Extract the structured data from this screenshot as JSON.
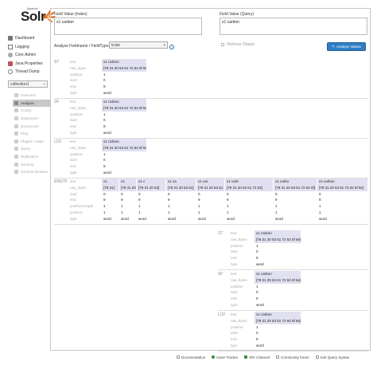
{
  "logo": {
    "apache": "Apache",
    "solr": "Solr"
  },
  "nav": [
    {
      "label": "Dashboard",
      "icon": "dashboard-icon"
    },
    {
      "label": "Logging",
      "icon": "logging-icon"
    },
    {
      "label": "Core Admin",
      "icon": "core-admin-icon"
    },
    {
      "label": "Java Properties",
      "icon": "java-icon"
    },
    {
      "label": "Thread Dump",
      "icon": "thread-icon"
    }
  ],
  "core_select": {
    "value": "collection1",
    "caret": "÷"
  },
  "sub_nav": [
    {
      "label": "Overview",
      "active": false
    },
    {
      "label": "Analysis",
      "active": true
    },
    {
      "label": "Config",
      "active": false
    },
    {
      "label": "Dataimport",
      "active": false
    },
    {
      "label": "Documents",
      "active": false
    },
    {
      "label": "Ping",
      "active": false
    },
    {
      "label": "Plugins / Stats",
      "active": false
    },
    {
      "label": "Query",
      "active": false
    },
    {
      "label": "Replication",
      "active": false
    },
    {
      "label": "Schema",
      "active": false
    },
    {
      "label": "Schema Browser",
      "active": false
    }
  ],
  "analysis": {
    "index_label": "Field Value (Index)",
    "index_value": "x1 carbon",
    "query_label": "Field Value (Query)",
    "query_value": "x1 carbon",
    "fieldtype_label": "Analyse Fieldname / FieldType:",
    "fieldtype_value": "field8",
    "help": "?",
    "verbose_label": "Verbose Output",
    "analyse_button": "Analyse Values"
  },
  "row_labels": [
    "text",
    "raw_bytes",
    "position",
    "start",
    "end",
    "type"
  ],
  "row_labels_long": [
    "text",
    "raw_bytes",
    "start",
    "end",
    "positionLength",
    "position",
    "type"
  ],
  "index_stages": [
    {
      "tag": "ST",
      "text": "x1 carbon",
      "raw_bytes": "[78 31 20 63 61 72 62 6f 6e]",
      "position": "1",
      "start": "0",
      "end": "9",
      "type": "word"
    },
    {
      "tag": "SF",
      "text": "x1 carbon",
      "raw_bytes": "[78 31 20 63 61 72 62 6f 6e]",
      "position": "1",
      "start": "0",
      "end": "9",
      "type": "word"
    },
    {
      "tag": "LCF",
      "text": "x1 carbon",
      "raw_bytes": "[78 31 20 63 61 72 62 6f 6e]",
      "position": "1",
      "start": "0",
      "end": "9",
      "type": "word"
    }
  ],
  "ngram_stage": {
    "tag": "ENGTF",
    "tokens": [
      {
        "text": "x1",
        "raw_bytes": "[78 31]",
        "start": "0",
        "end": "9",
        "positionLength": "1",
        "position": "1",
        "type": "word"
      },
      {
        "text": "x1",
        "raw_bytes": "[78 31 20]",
        "start": "0",
        "end": "9",
        "positionLength": "1",
        "position": "1",
        "type": "word"
      },
      {
        "text": "x1 c",
        "raw_bytes": "[78 31 20 63]",
        "start": "0",
        "end": "9",
        "positionLength": "1",
        "position": "1",
        "type": "word"
      },
      {
        "text": "x1 ca",
        "raw_bytes": "[78 31 20 63 61]",
        "start": "0",
        "end": "9",
        "positionLength": "1",
        "position": "1",
        "type": "word"
      },
      {
        "text": "x1 car",
        "raw_bytes": "[78 31 20 63 61 72]",
        "start": "0",
        "end": "9",
        "positionLength": "1",
        "position": "1",
        "type": "word"
      },
      {
        "text": "x1 carb",
        "raw_bytes": "[78 31 20 63 61 72 62]",
        "start": "0",
        "end": "9",
        "positionLength": "1",
        "position": "1",
        "type": "word"
      },
      {
        "text": "x1 carbo",
        "raw_bytes": "[78 31 20 63 61 72 62 6f]",
        "start": "0",
        "end": "9",
        "positionLength": "1",
        "position": "1",
        "type": "word"
      },
      {
        "text": "x1 carbon",
        "raw_bytes": "[78 31 20 63 61 72 62 6f 6e]",
        "start": "0",
        "end": "9",
        "positionLength": "1",
        "position": "1",
        "type": "word"
      }
    ]
  },
  "query_stages": [
    {
      "tag": "ST",
      "text": "x1 carbon",
      "raw_bytes": "[78 31 20 63 61 72 62 6f 6e]",
      "position": "1",
      "start": "0",
      "end": "9",
      "type": "word"
    },
    {
      "tag": "SF",
      "text": "x1 carbon",
      "raw_bytes": "[78 31 20 63 61 72 62 6f 6e]",
      "position": "1",
      "start": "0",
      "end": "9",
      "type": "word"
    },
    {
      "tag": "LCF",
      "text": "x1 carbon",
      "raw_bytes": "[78 31 20 63 61 72 62 6f 6e]",
      "position": "1",
      "start": "0",
      "end": "9",
      "type": "word"
    }
  ],
  "footer": [
    {
      "label": "Documentation",
      "icon": "documentation-icon",
      "color": "#999"
    },
    {
      "label": "Issue Tracker",
      "icon": "issue-tracker-icon",
      "color": "#3a8a3a"
    },
    {
      "label": "IRC Channel",
      "icon": "irc-icon",
      "color": "#3a8a3a"
    },
    {
      "label": "Community forum",
      "icon": "community-icon",
      "color": "#999"
    },
    {
      "label": "Solr Query Syntax",
      "icon": "query-syntax-icon",
      "color": "#999"
    }
  ]
}
